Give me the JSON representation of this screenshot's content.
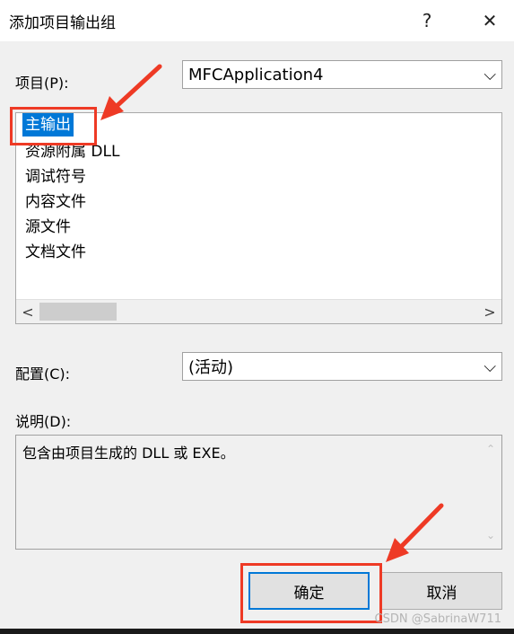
{
  "window": {
    "title": "添加项目输出组",
    "help_glyph": "?",
    "close_glyph": "✕"
  },
  "project": {
    "label": "项目(P):",
    "value": "MFCApplication4",
    "chevron": "⌵"
  },
  "outputs": {
    "items": [
      "主输出",
      "资源附属 DLL",
      "调试符号",
      "内容文件",
      "源文件",
      "文档文件"
    ],
    "selected_index": 0,
    "scroll_left": "<",
    "scroll_right": ">"
  },
  "config": {
    "label": "配置(C):",
    "value": "(活动)",
    "chevron": "⌵"
  },
  "description": {
    "label": "说明(D):",
    "text": "包含由项目生成的 DLL 或 EXE。",
    "scroll_up": "⌃",
    "scroll_down": "⌄"
  },
  "buttons": {
    "ok": "确定",
    "cancel": "取消"
  },
  "watermark": "CSDN @SabrinaW711",
  "annotation_color": "#ee3a25",
  "selection_color": "#0078d7"
}
